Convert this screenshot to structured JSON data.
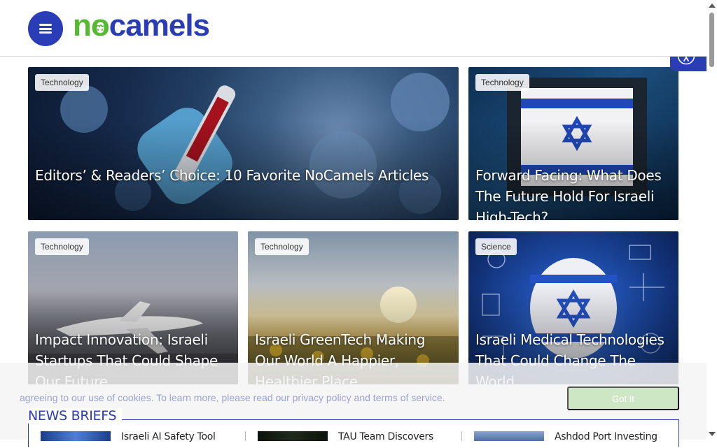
{
  "header": {
    "logo_n": "n",
    "logo_o": "o",
    "logo_rest": "camels",
    "menu_icon": "hamburger-menu-icon",
    "accessibility_icon": "accessibility-icon"
  },
  "colors": {
    "brand_blue": "#2b3cb7",
    "brand_green": "#55b830"
  },
  "cards": [
    {
      "tag": "Technology",
      "title": "Editors’ & Readers’ Choice: 10 Favorite NoCamels Articles"
    },
    {
      "tag": "Technology",
      "title": "Forward Facing: What Does The Future Hold For Israeli High-Tech?"
    },
    {
      "tag": "Technology",
      "title": "Impact Innovation: Israeli Startups That Could Shape Our Future"
    },
    {
      "tag": "Technology",
      "title": "Israeli GreenTech Making Our World A Happier, Healthier Place"
    },
    {
      "tag": "Science",
      "title": "Israeli Medical Technologies That Could Change The World"
    }
  ],
  "cookie": {
    "text": "agreeing to our use of cookies. To learn more, please read our privacy policy and terms of service.",
    "button": "Got It"
  },
  "news_briefs": {
    "heading": "NEWS BRIEFS",
    "items": [
      {
        "title": "Israeli AI Safety Tool"
      },
      {
        "title": "TAU Team Discovers"
      },
      {
        "title": "Ashdod Port Investing"
      }
    ]
  }
}
